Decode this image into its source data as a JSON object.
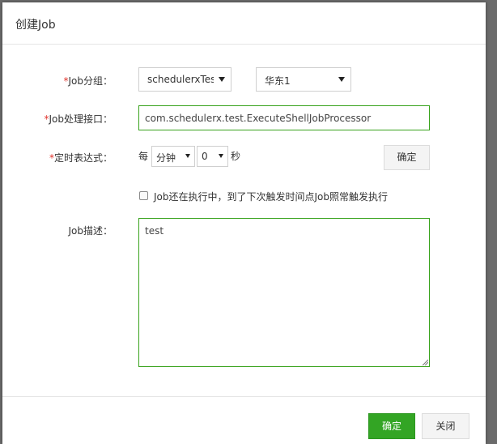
{
  "dialog": {
    "title": "创建Job"
  },
  "form": {
    "group": {
      "required_mark": "*",
      "label": "Job分组：",
      "group_select_value": "schedulerxTest",
      "region_select_value": "华东1"
    },
    "processor": {
      "required_mark": "*",
      "label": "Job处理接口：",
      "value": "com.schedulerx.test.ExecuteShellJobProcessor"
    },
    "cron": {
      "required_mark": "*",
      "label": "定时表达式：",
      "prefix": "每",
      "unit_select_value": "分钟",
      "number_select_value": "0",
      "suffix": "秒",
      "confirm_label": "确定"
    },
    "overlap": {
      "checked": false,
      "label": "Job还在执行中，到了下次触发时间点Job照常触发执行"
    },
    "description": {
      "label": "Job描述：",
      "value": "test"
    }
  },
  "footer": {
    "ok_label": "确定",
    "close_label": "关闭"
  },
  "colors": {
    "required": "#e0322b",
    "accent_green": "#33a524",
    "input_border_focus": "#37a21b"
  }
}
